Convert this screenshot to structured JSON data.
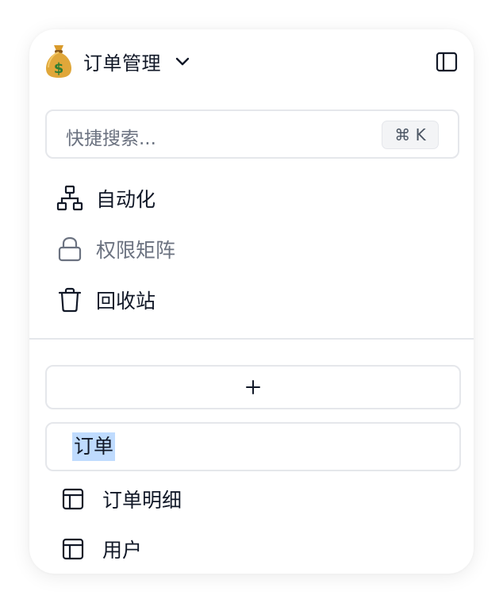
{
  "workspace": {
    "icon": "money-bag-icon",
    "title": "订单管理",
    "dropdown_icon": "chevron-down-icon"
  },
  "header": {
    "toggle_icon": "sidebar-toggle-icon"
  },
  "search": {
    "placeholder": "快捷搜索...",
    "shortcut": "⌘ K"
  },
  "nav": {
    "items": [
      {
        "icon": "sitemap-icon",
        "label": "自动化"
      },
      {
        "icon": "lock-icon",
        "label": "权限矩阵",
        "muted": true
      },
      {
        "icon": "trash-icon",
        "label": "回收站"
      }
    ]
  },
  "tables": {
    "add_icon": "plus-icon",
    "editing_value": "订单",
    "items": [
      {
        "icon": "table-icon",
        "label": "订单明细"
      },
      {
        "icon": "table-icon",
        "label": "用户"
      }
    ]
  },
  "colors": {
    "text": "#111827",
    "muted": "#6b7280",
    "border": "#e5e7eb",
    "selection": "#bfdbfe"
  }
}
